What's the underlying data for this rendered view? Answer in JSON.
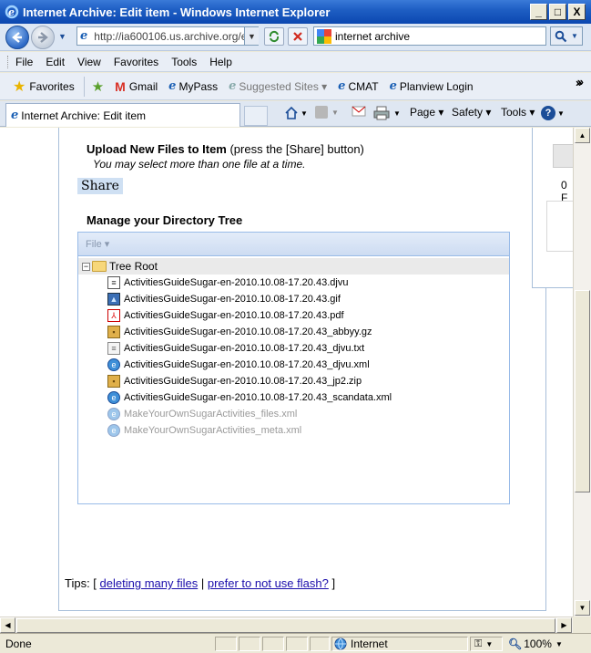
{
  "window": {
    "title": "Internet Archive: Edit item - Windows Internet Explorer",
    "buttons": {
      "minimize": "_",
      "maximize": "□",
      "close": "X"
    }
  },
  "navigation": {
    "address": "http://ia600106.us.archive.org/e",
    "search_value": "internet archive"
  },
  "menu": [
    "File",
    "Edit",
    "View",
    "Favorites",
    "Tools",
    "Help"
  ],
  "favorites_bar": {
    "favorites_label": "Favorites",
    "links": [
      "Gmail",
      "MyPass",
      "Suggested Sites ▾",
      "CMAT",
      "Planview Login"
    ],
    "overflow": "»"
  },
  "tab": {
    "title": "Internet Archive: Edit item"
  },
  "command_bar": {
    "page": "Page ▾",
    "safety": "Safety ▾",
    "tools": "Tools ▾",
    "overflow": "»"
  },
  "page": {
    "upload_title": "Upload New Files to Item",
    "upload_title_suffix": " (press the [Share] button)",
    "upload_hint": "You may select more than one file at a time.",
    "share_button": "Share",
    "manage_title": "Manage your Directory Tree",
    "tree_toolbar_file": "File ▾",
    "tree_root": "Tree Root",
    "files": [
      {
        "name": "ActivitiesGuideSugar-en-2010.10.08-17.20.43.djvu",
        "icon": "djvu-icon",
        "dim": false
      },
      {
        "name": "ActivitiesGuideSugar-en-2010.10.08-17.20.43.gif",
        "icon": "image-icon",
        "dim": false
      },
      {
        "name": "ActivitiesGuideSugar-en-2010.10.08-17.20.43.pdf",
        "icon": "pdf-icon",
        "dim": false
      },
      {
        "name": "ActivitiesGuideSugar-en-2010.10.08-17.20.43_abbyy.gz",
        "icon": "archive-icon",
        "dim": false
      },
      {
        "name": "ActivitiesGuideSugar-en-2010.10.08-17.20.43_djvu.txt",
        "icon": "text-icon",
        "dim": false
      },
      {
        "name": "ActivitiesGuideSugar-en-2010.10.08-17.20.43_djvu.xml",
        "icon": "xml-icon",
        "dim": false
      },
      {
        "name": "ActivitiesGuideSugar-en-2010.10.08-17.20.43_jp2.zip",
        "icon": "archive-icon",
        "dim": false
      },
      {
        "name": "ActivitiesGuideSugar-en-2010.10.08-17.20.43_scandata.xml",
        "icon": "xml-icon",
        "dim": false
      },
      {
        "name": "MakeYourOwnSugarActivities_files.xml",
        "icon": "xml-icon",
        "dim": true
      },
      {
        "name": "MakeYourOwnSugarActivities_meta.xml",
        "icon": "xml-icon",
        "dim": true
      }
    ],
    "tips_prefix": "Tips: [",
    "tips_link1": "deleting many files",
    "tips_sep": "|",
    "tips_link2": "prefer to not use flash?",
    "tips_suffix": "]",
    "side_value": "0 F"
  },
  "statusbar": {
    "status": "Done",
    "zone": "Internet",
    "zoom": "100%"
  }
}
